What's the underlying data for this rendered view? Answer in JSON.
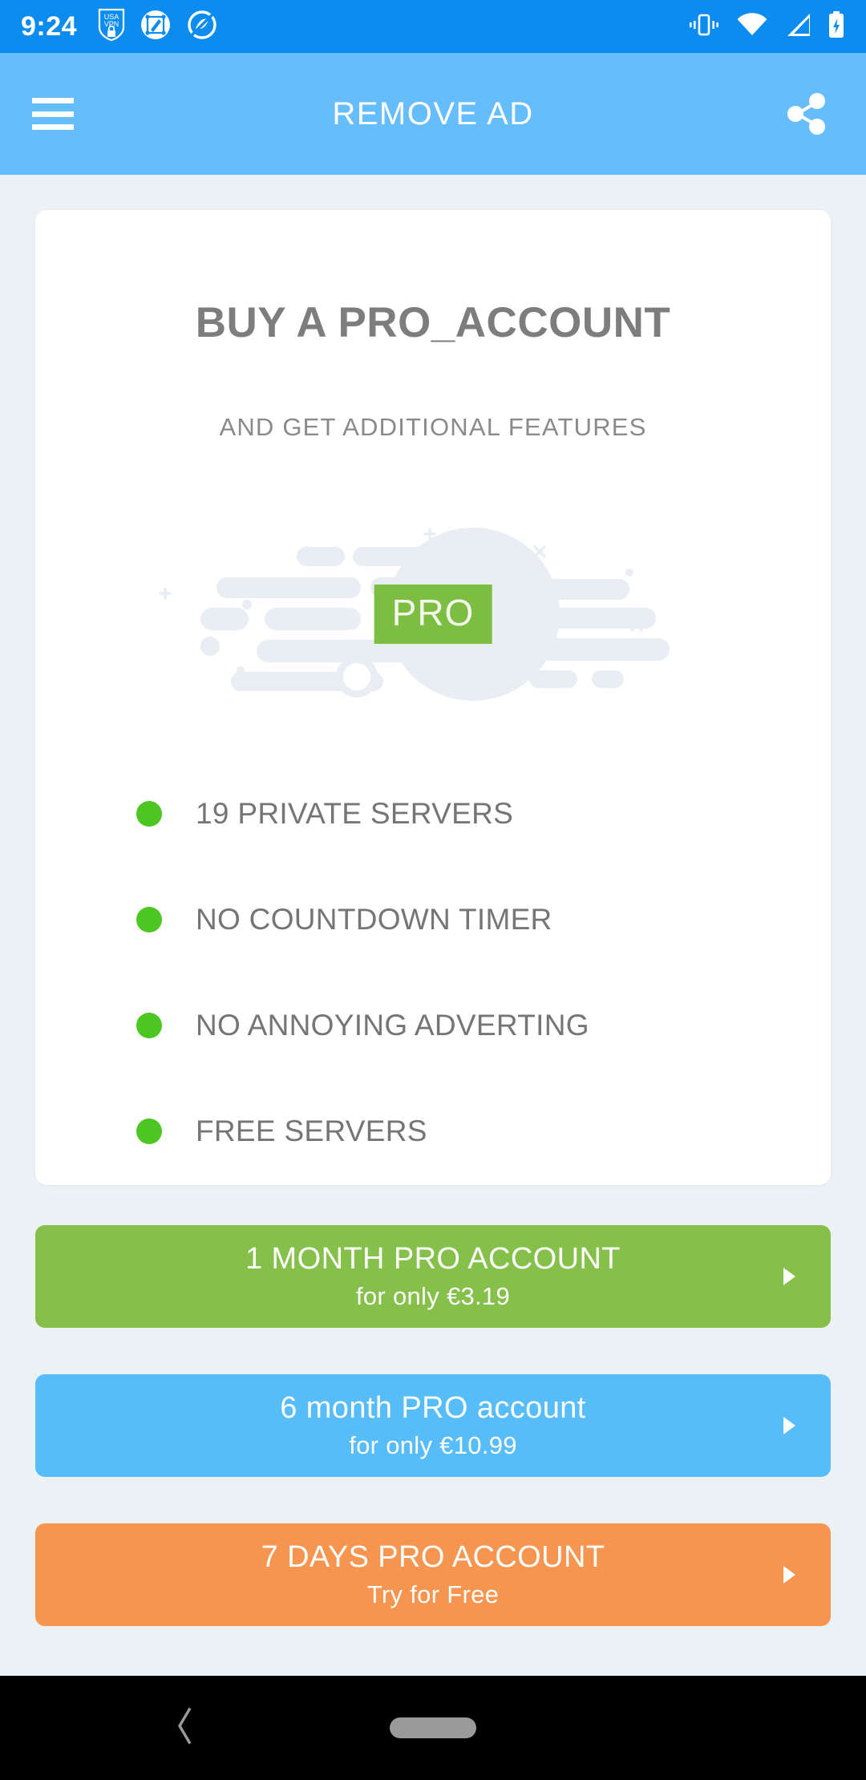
{
  "status_bar": {
    "time": "9:24",
    "left_icons": [
      "usa-vpn-shield-icon",
      "screenshot-edit-icon",
      "adblock-icon"
    ],
    "right_icons": [
      "vibrate-icon",
      "wifi-icon",
      "cell-signal-icon",
      "battery-charging-icon"
    ],
    "background_color": "#0C8CEE",
    "vpn_label_top": "USA",
    "vpn_label_bottom": "VPN"
  },
  "app_bar": {
    "title": "REMOVE AD",
    "menu_icon": "hamburger-menu-icon",
    "share_icon": "share-icon",
    "background_color": "#65BDFB"
  },
  "card": {
    "title": "BUY A PRO_ACCOUNT",
    "subtitle": "AND GET ADDITIONAL FEATURES",
    "badge_label": "PRO",
    "badge_color": "#7CBE42",
    "bullet_color": "#4CC722",
    "features": [
      {
        "label": "19 PRIVATE SERVERS"
      },
      {
        "label": "NO COUNTDOWN TIMER"
      },
      {
        "label": "NO ANNOYING ADVERTING"
      },
      {
        "label": "FREE SERVERS"
      }
    ]
  },
  "plans": [
    {
      "title": "1 MONTH PRO ACCOUNT",
      "subtitle": "for only €3.19",
      "color": "#85C04A",
      "arrow_icon": "chevron-right-icon"
    },
    {
      "title": "6 month PRO account",
      "subtitle": "for only €10.99",
      "color": "#57BDF8",
      "arrow_icon": "chevron-right-icon"
    },
    {
      "title": "7 DAYS PRO ACCOUNT",
      "subtitle": "Try for Free",
      "color": "#F6954F",
      "arrow_icon": "chevron-right-icon"
    }
  ],
  "nav_bar": {
    "back_icon": "back-chevron-icon",
    "home_pill_icon": "home-gesture-pill-icon",
    "background_color": "#000000"
  },
  "page": {
    "background_color": "#ECF1F5"
  }
}
